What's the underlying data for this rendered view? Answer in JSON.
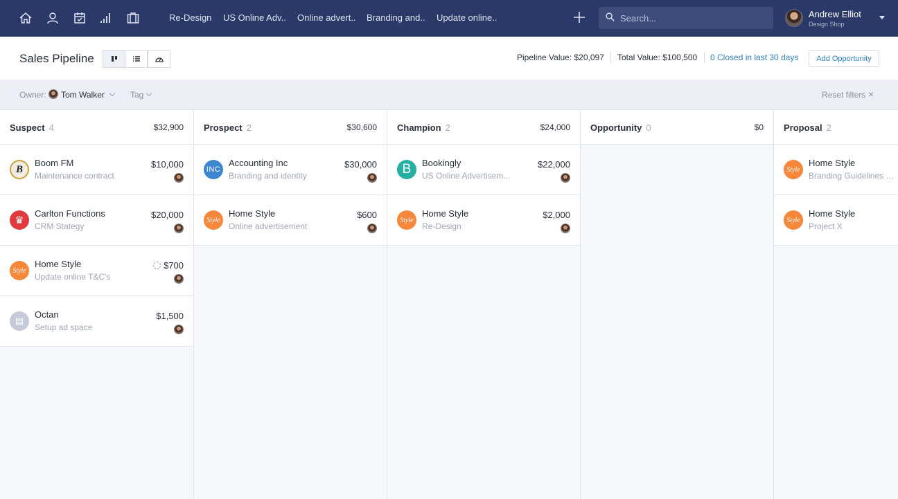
{
  "nav": {
    "icons": [
      "home-icon",
      "user-icon",
      "calendar-icon",
      "bar-chart-icon",
      "briefcase-icon"
    ],
    "tabs": [
      "Re-Design",
      "US Online Adv..",
      "Online advert..",
      "Branding and..",
      "Update online.."
    ],
    "search_placeholder": "Search...",
    "user_name": "Andrew Elliot",
    "user_org": "Design Shop"
  },
  "header": {
    "title": "Sales Pipeline",
    "pipeline_value": "Pipeline Value: $20,097",
    "total_value": "Total Value: $100,500",
    "closed_link": "0 Closed in last 30 days",
    "add_button": "Add Opportunity"
  },
  "filters": {
    "owner_label": "Owner:",
    "owner_name": "Tom Walker",
    "tag_label": "Tag",
    "reset_label": "Reset filters",
    "reset_icon": "×"
  },
  "columns": [
    {
      "name": "Suspect",
      "count": "4",
      "total": "$32,900",
      "cards": [
        {
          "title": "Boom FM",
          "subtitle": "Maintenance contract",
          "value": "$10,000",
          "logo": "B"
        },
        {
          "title": "Carlton Functions",
          "subtitle": "CRM Stategy",
          "value": "$20,000",
          "logo": "♛"
        },
        {
          "title": "Home Style",
          "subtitle": "Update online T&C's",
          "value": "$700",
          "logo": "Style"
        },
        {
          "title": "Octan",
          "subtitle": "Setup ad space",
          "value": "$1,500",
          "logo": "▤"
        }
      ]
    },
    {
      "name": "Prospect",
      "count": "2",
      "total": "$30,600",
      "cards": [
        {
          "title": "Accounting Inc",
          "subtitle": "Branding and identity",
          "value": "$30,000",
          "logo": "INC"
        },
        {
          "title": "Home Style",
          "subtitle": "Online advertisement",
          "value": "$600",
          "logo": "Style"
        }
      ]
    },
    {
      "name": "Champion",
      "count": "2",
      "total": "$24,000",
      "cards": [
        {
          "title": "Bookingly",
          "subtitle": "US Online Advertisem...",
          "value": "$22,000",
          "logo": "B"
        },
        {
          "title": "Home Style",
          "subtitle": "Re-Design",
          "value": "$2,000",
          "logo": "Style"
        }
      ]
    },
    {
      "name": "Opportunity",
      "count": "0",
      "total": "$0",
      "cards": []
    },
    {
      "name": "Proposal",
      "count": "2",
      "total": "",
      "cards": [
        {
          "title": "Home Style",
          "subtitle": "Branding Guidelines P...",
          "value": "",
          "logo": "Style"
        },
        {
          "title": "Home Style",
          "subtitle": "Project X",
          "value": "",
          "logo": "Style"
        }
      ]
    }
  ],
  "colors": {
    "nav_bg": "#2a3968",
    "link": "#2f7fc1",
    "home_style": "#f7873a",
    "bookingly": "#26b0a4",
    "accounting": "#3e86cf",
    "carlton": "#e0393e",
    "octan": "#c5cad8"
  }
}
